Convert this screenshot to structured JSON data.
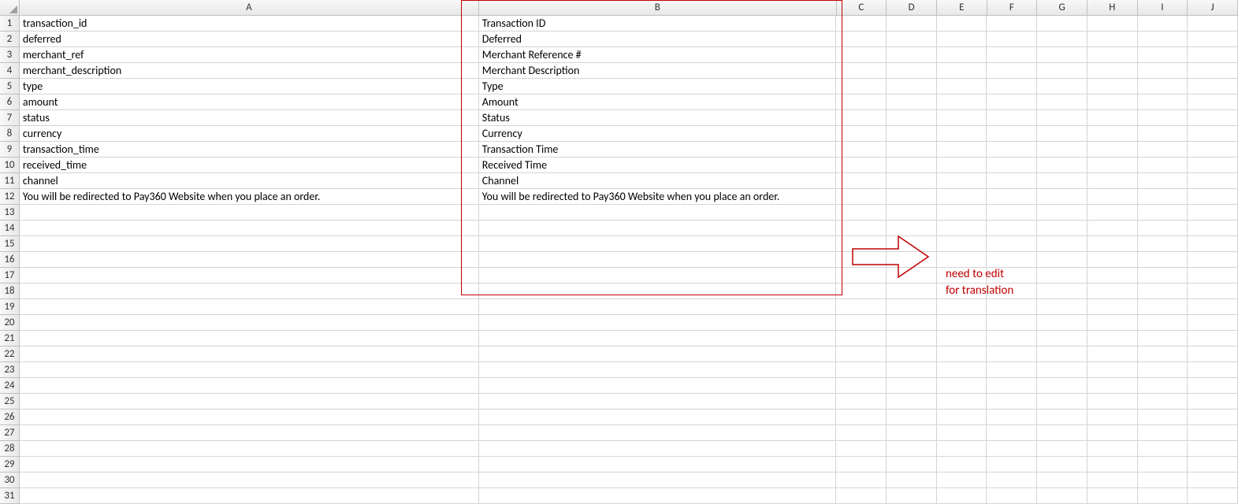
{
  "columns": [
    "A",
    "B",
    "C",
    "D",
    "E",
    "F",
    "G",
    "H",
    "I",
    "J"
  ],
  "total_rows": 31,
  "rows": [
    {
      "num": "1",
      "A": "transaction_id",
      "B": "Transaction ID"
    },
    {
      "num": "2",
      "A": "deferred",
      "B": "Deferred"
    },
    {
      "num": "3",
      "A": "merchant_ref",
      "B": "Merchant Reference #"
    },
    {
      "num": "4",
      "A": "merchant_description",
      "B": "Merchant Description"
    },
    {
      "num": "5",
      "A": "type",
      "B": "Type"
    },
    {
      "num": "6",
      "A": "amount",
      "B": "Amount"
    },
    {
      "num": "7",
      "A": "status",
      "B": "Status"
    },
    {
      "num": "8",
      "A": "currency",
      "B": "Currency"
    },
    {
      "num": "9",
      "A": "transaction_time",
      "B": "Transaction Time"
    },
    {
      "num": "10",
      "A": "received_time",
      "B": "Received Time"
    },
    {
      "num": "11",
      "A": "channel",
      "B": "Channel"
    },
    {
      "num": "12",
      "A": "You will be redirected to Pay360 Website when you place an order.",
      "B": "You will be redirected to Pay360 Website when you place an order."
    }
  ],
  "annotation": {
    "line1": "need to edit",
    "line2": "for translation"
  }
}
